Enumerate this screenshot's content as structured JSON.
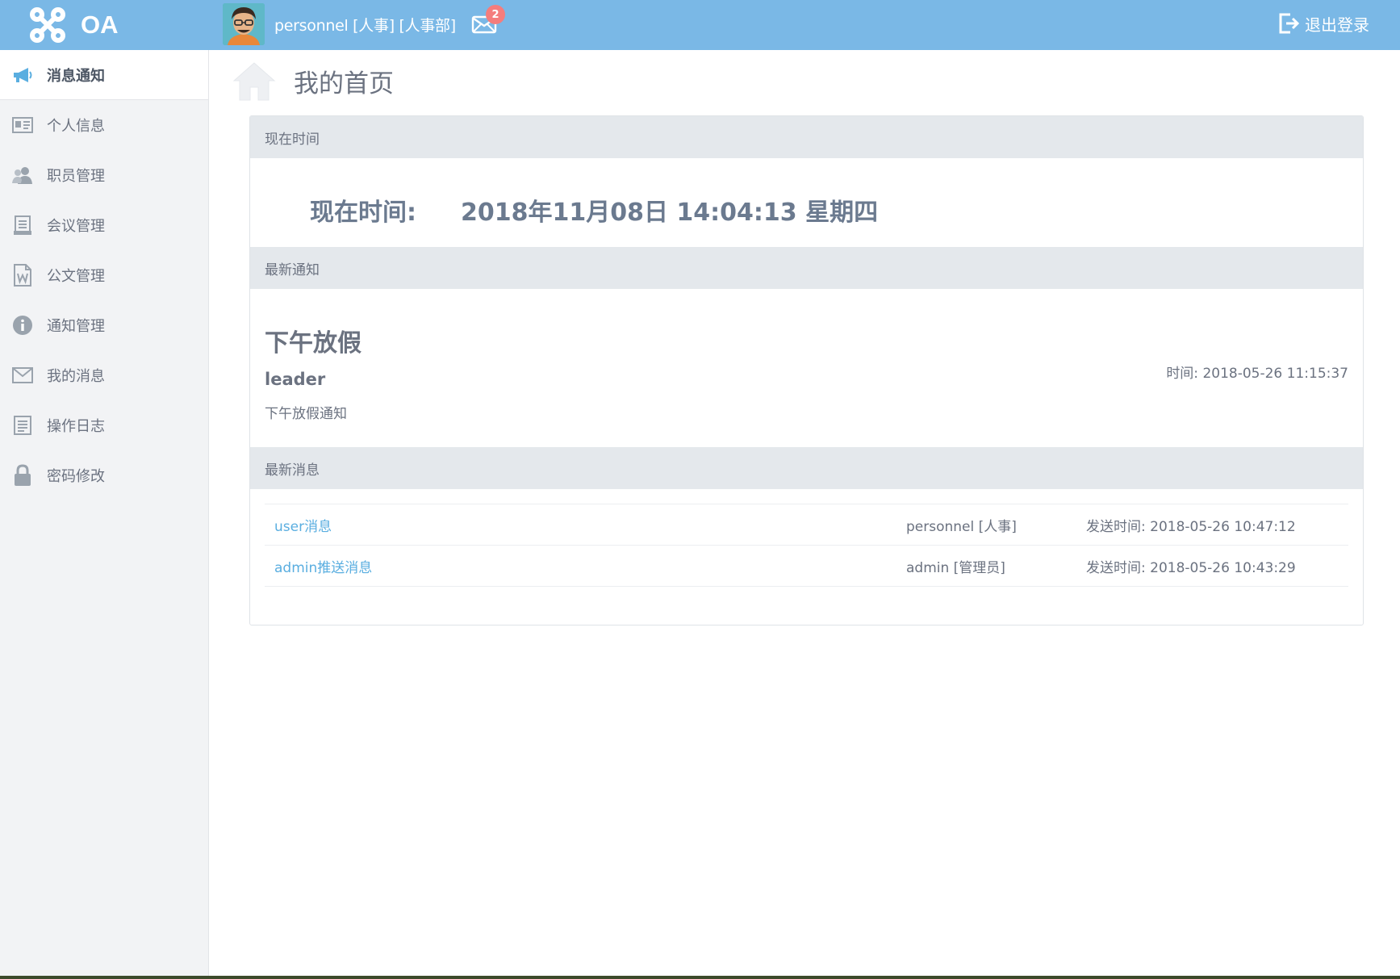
{
  "header": {
    "logo_text": "OA",
    "user_text": "personnel [人事] [人事部]",
    "mail_badge": "2",
    "logout_label": "退出登录"
  },
  "sidebar": {
    "items": [
      {
        "label": "消息通知",
        "icon": "megaphone-icon",
        "active": true
      },
      {
        "label": "个人信息",
        "icon": "id-card-icon"
      },
      {
        "label": "职员管理",
        "icon": "users-icon"
      },
      {
        "label": "会议管理",
        "icon": "notepad-icon"
      },
      {
        "label": "公文管理",
        "icon": "word-document-icon"
      },
      {
        "label": "通知管理",
        "icon": "info-icon"
      },
      {
        "label": "我的消息",
        "icon": "envelope-icon"
      },
      {
        "label": "操作日志",
        "icon": "list-icon"
      },
      {
        "label": "密码修改",
        "icon": "lock-icon"
      }
    ]
  },
  "page": {
    "title": "我的首页"
  },
  "time_section": {
    "header": "现在时间",
    "label": "现在时间:",
    "value": "2018年11月08日 14:04:13 星期四"
  },
  "notice_section": {
    "header": "最新通知",
    "title": "下午放假",
    "author": "leader",
    "description": "下午放假通知",
    "time": "时间:  2018-05-26 11:15:37"
  },
  "message_section": {
    "header": "最新消息",
    "rows": [
      {
        "title": "user消息",
        "from": "personnel [人事]",
        "time": "发送时间:  2018-05-26 10:47:12"
      },
      {
        "title": "admin推送消息",
        "from": "admin [管理员]",
        "time": "发送时间:  2018-05-26 10:43:29"
      }
    ]
  },
  "colors": {
    "topbar": "#7ab8e6",
    "link": "#5aaee0",
    "section_header": "#e4e8ec",
    "badge": "#f47d7d"
  }
}
